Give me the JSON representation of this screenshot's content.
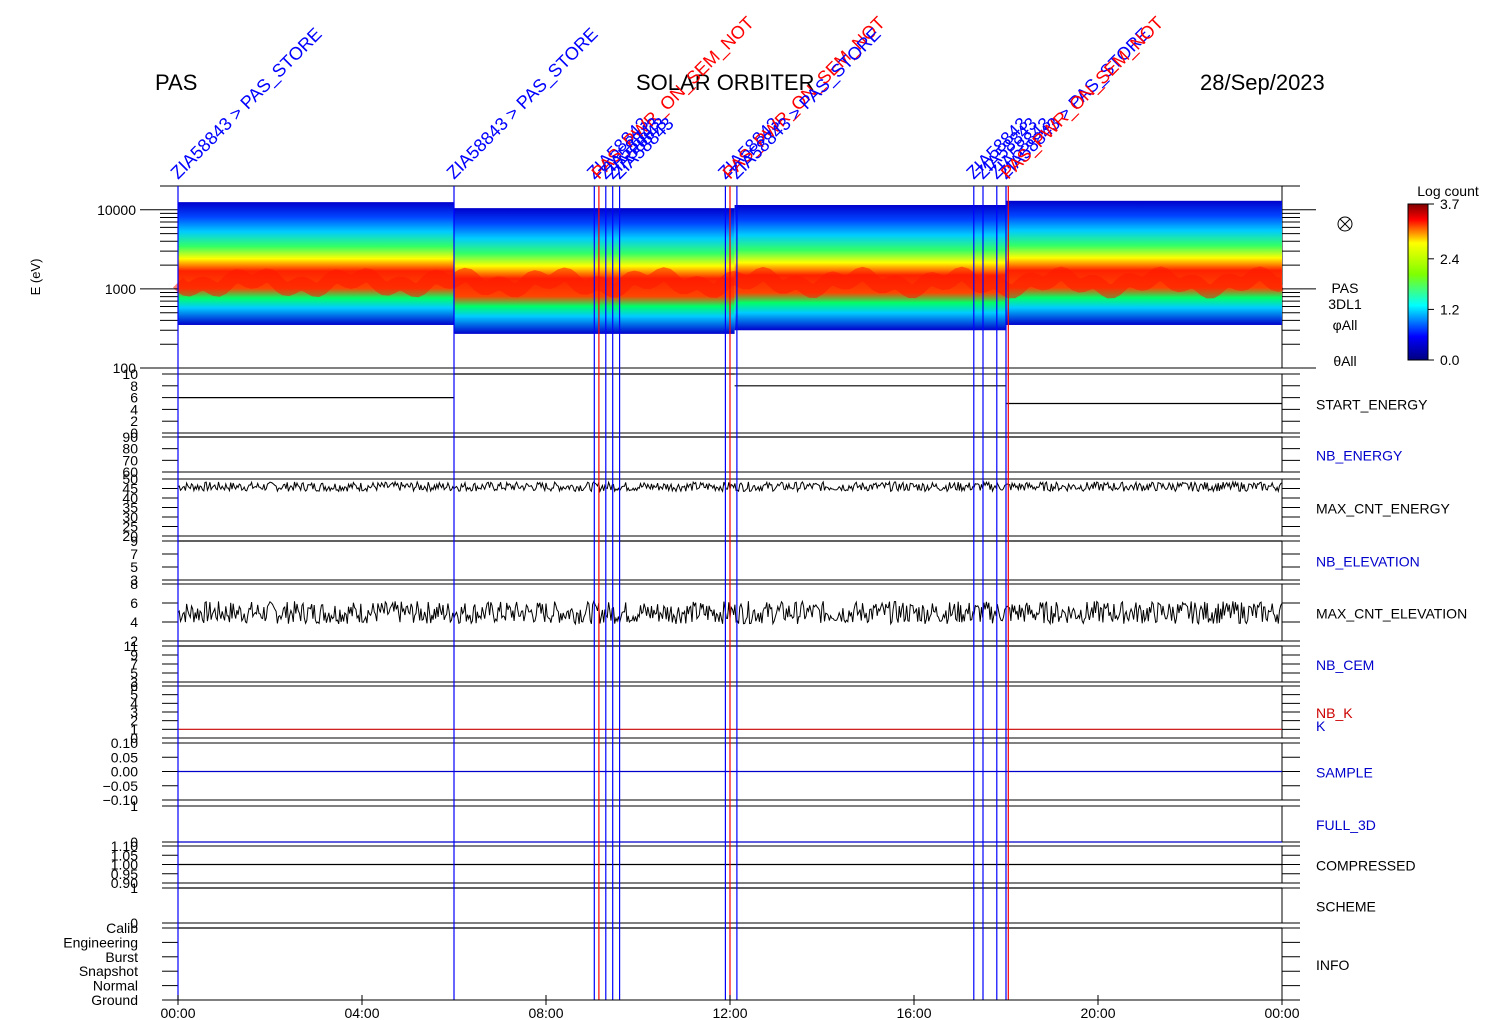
{
  "header": {
    "left": "PAS",
    "center": "SOLAR ORBITER",
    "right": "28/Sep/2023"
  },
  "chart_data": {
    "type": "heatmap",
    "xlabel": "",
    "x_ticks": [
      "00:00",
      "04:00",
      "08:00",
      "12:00",
      "16:00",
      "20:00",
      "00:00"
    ],
    "x_range_hours": [
      0,
      24
    ],
    "spectrogram": {
      "ylabel": "E (eV)",
      "scale": "log",
      "ylim": [
        100,
        20000
      ],
      "y_ticks": [
        "10000",
        "1000",
        "100"
      ],
      "right_labels": [
        "PAS",
        "3DL1",
        "φAll",
        "θAll"
      ],
      "colorbar": {
        "title": "Log count",
        "ticks": [
          "3.7",
          "2.4",
          "1.2",
          "0.0"
        ],
        "range": [
          0.0,
          3.7
        ]
      },
      "segments": [
        {
          "start_h": 0.0,
          "end_h": 6.0,
          "e_min": 350,
          "e_max": 12500
        },
        {
          "start_h": 6.0,
          "end_h": 12.1,
          "e_min": 270,
          "e_max": 10500
        },
        {
          "start_h": 12.1,
          "end_h": 18.0,
          "e_min": 300,
          "e_max": 11500
        },
        {
          "start_h": 18.0,
          "end_h": 24.0,
          "e_min": 350,
          "e_max": 13000
        }
      ],
      "peak_energy_ev": 1200
    },
    "event_markers": [
      {
        "time_h": 0.0,
        "color": "#0000ff",
        "label": "ZIA58843 > PAS_STORE"
      },
      {
        "time_h": 6.0,
        "color": "#0000ff",
        "label": "ZIA58843 > PAS_STORE"
      },
      {
        "time_h": 9.05,
        "color": "#0000ff",
        "label": "ZIA58843"
      },
      {
        "time_h": 9.15,
        "color": "#ff0000",
        "label": "PAS_PWR_ON_SEM_NOT"
      },
      {
        "time_h": 9.3,
        "color": "#0000ff",
        "label": "ZIA58843"
      },
      {
        "time_h": 9.45,
        "color": "#0000ff",
        "label": "ZIA58843"
      },
      {
        "time_h": 9.6,
        "color": "#0000ff",
        "label": "ZIA58843"
      },
      {
        "time_h": 11.9,
        "color": "#0000ff",
        "label": "ZIA58843"
      },
      {
        "time_h": 12.0,
        "color": "#ff0000",
        "label": "PAS_PWR_ON_SEM_NOT"
      },
      {
        "time_h": 12.15,
        "color": "#0000ff",
        "label": "ZIA58843 > PAS_STORE"
      },
      {
        "time_h": 17.3,
        "color": "#0000ff",
        "label": "ZIA58843"
      },
      {
        "time_h": 17.5,
        "color": "#0000ff",
        "label": "ZIA58843"
      },
      {
        "time_h": 17.8,
        "color": "#0000ff",
        "label": "ZIA58843"
      },
      {
        "time_h": 18.0,
        "color": "#0000ff",
        "label": "ZIA58843 > PAS_STORE"
      },
      {
        "time_h": 18.05,
        "color": "#ff0000",
        "label": "PAS_PWR_ON_SEM_NOT"
      }
    ],
    "panels": [
      {
        "name": "START_ENERGY",
        "label_color": "#000000",
        "y_ticks": [
          "10",
          "8",
          "6",
          "4",
          "2",
          "0"
        ],
        "ylim": [
          0,
          10
        ],
        "dashed_zero": true,
        "series": [
          {
            "time_h": [
              0,
              6.0
            ],
            "value": 6
          },
          {
            "time_h": [
              6.0,
              12.1
            ],
            "value": 10
          },
          {
            "time_h": [
              12.1,
              18.0
            ],
            "value": 8
          },
          {
            "time_h": [
              18.0,
              24
            ],
            "value": 5
          }
        ]
      },
      {
        "name": "NB_ENERGY",
        "label_color": "#0000cc",
        "y_ticks": [
          "90",
          "80",
          "70",
          "60"
        ],
        "ylim": [
          60,
          90
        ],
        "dashed_zero": false,
        "series": [
          {
            "time_h": [
              0,
              24
            ],
            "value": 90
          }
        ]
      },
      {
        "name": "MAX_CNT_ENERGY",
        "label_color": "#000000",
        "y_ticks": [
          "50",
          "45",
          "40",
          "35",
          "30",
          "25",
          "20"
        ],
        "ylim": [
          20,
          50
        ],
        "dashed_zero": false,
        "noisy": {
          "base": 46,
          "amp": 2.5
        }
      },
      {
        "name": "NB_ELEVATION",
        "label_color": "#0000cc",
        "y_ticks": [
          "9",
          "7",
          "5",
          "3"
        ],
        "ylim": [
          3,
          9
        ],
        "dashed_zero": false,
        "series": [
          {
            "time_h": [
              0,
              24
            ],
            "value": 9
          }
        ]
      },
      {
        "name": "MAX_CNT_ELEVATION",
        "label_color": "#000000",
        "y_ticks": [
          "8",
          "6",
          "4",
          "2"
        ],
        "ylim": [
          2,
          8
        ],
        "dashed_zero": false,
        "noisy": {
          "base": 5,
          "amp": 1.2
        }
      },
      {
        "name": "NB_CEM",
        "label_color": "#0000cc",
        "y_ticks": [
          "11",
          "9",
          "7",
          "5",
          "3"
        ],
        "ylim": [
          3,
          11
        ],
        "dashed_zero": false,
        "series": [
          {
            "time_h": [
              0,
              24
            ],
            "value": 11
          }
        ]
      },
      {
        "name": "NB_K",
        "label_color": "#cc0000",
        "y_ticks": [
          "6",
          "5",
          "4",
          "3",
          "2",
          "1",
          "0"
        ],
        "ylim": [
          0,
          6
        ],
        "dashed_zero": true,
        "series": [
          {
            "time_h": [
              0,
              24
            ],
            "value": 1,
            "color": "#cc0000"
          }
        ]
      },
      {
        "name": "K",
        "label_color": "#0000cc",
        "inline": true
      },
      {
        "name": "SAMPLE",
        "label_color": "#0000cc",
        "y_ticks": [
          "0.10",
          "0.05",
          "0.00",
          "−0.05",
          "−0.10"
        ],
        "ylim": [
          -0.1,
          0.1
        ],
        "dashed_zero": false,
        "series": [
          {
            "time_h": [
              0,
              24
            ],
            "value": 0,
            "color": "#0000cc"
          }
        ]
      },
      {
        "name": "FULL_3D",
        "label_color": "#0000cc",
        "y_ticks": [
          "1",
          "0"
        ],
        "ylim": [
          0,
          1
        ],
        "dashed_zero": false,
        "series": [
          {
            "time_h": [
              0,
              24
            ],
            "value": 0,
            "color": "#0000cc"
          }
        ]
      },
      {
        "name": "COMPRESSED",
        "label_color": "#000000",
        "y_ticks": [
          "1.10",
          "1.05",
          "1.00",
          "0.95",
          "0.90"
        ],
        "ylim": [
          0.9,
          1.1
        ],
        "dashed_zero": false,
        "series": [
          {
            "time_h": [
              0,
              24
            ],
            "value": 1.0
          }
        ]
      },
      {
        "name": "SCHEME",
        "label_color": "#000000",
        "y_ticks": [
          "1",
          "0"
        ],
        "ylim": [
          0,
          1
        ],
        "dashed_zero": false,
        "series": [
          {
            "time_h": [
              0,
              24
            ],
            "value": 1
          }
        ]
      },
      {
        "name": "INFO",
        "label_color": "#000000",
        "y_ticks": [
          "Calib",
          "Engineering",
          "Burst",
          "Snapshot",
          "Normal",
          "Ground"
        ],
        "ylim": [
          0,
          5
        ],
        "dashed_zero": false,
        "series": [
          {
            "time_h": [
              0,
              24
            ],
            "value": 5
          }
        ]
      }
    ]
  }
}
